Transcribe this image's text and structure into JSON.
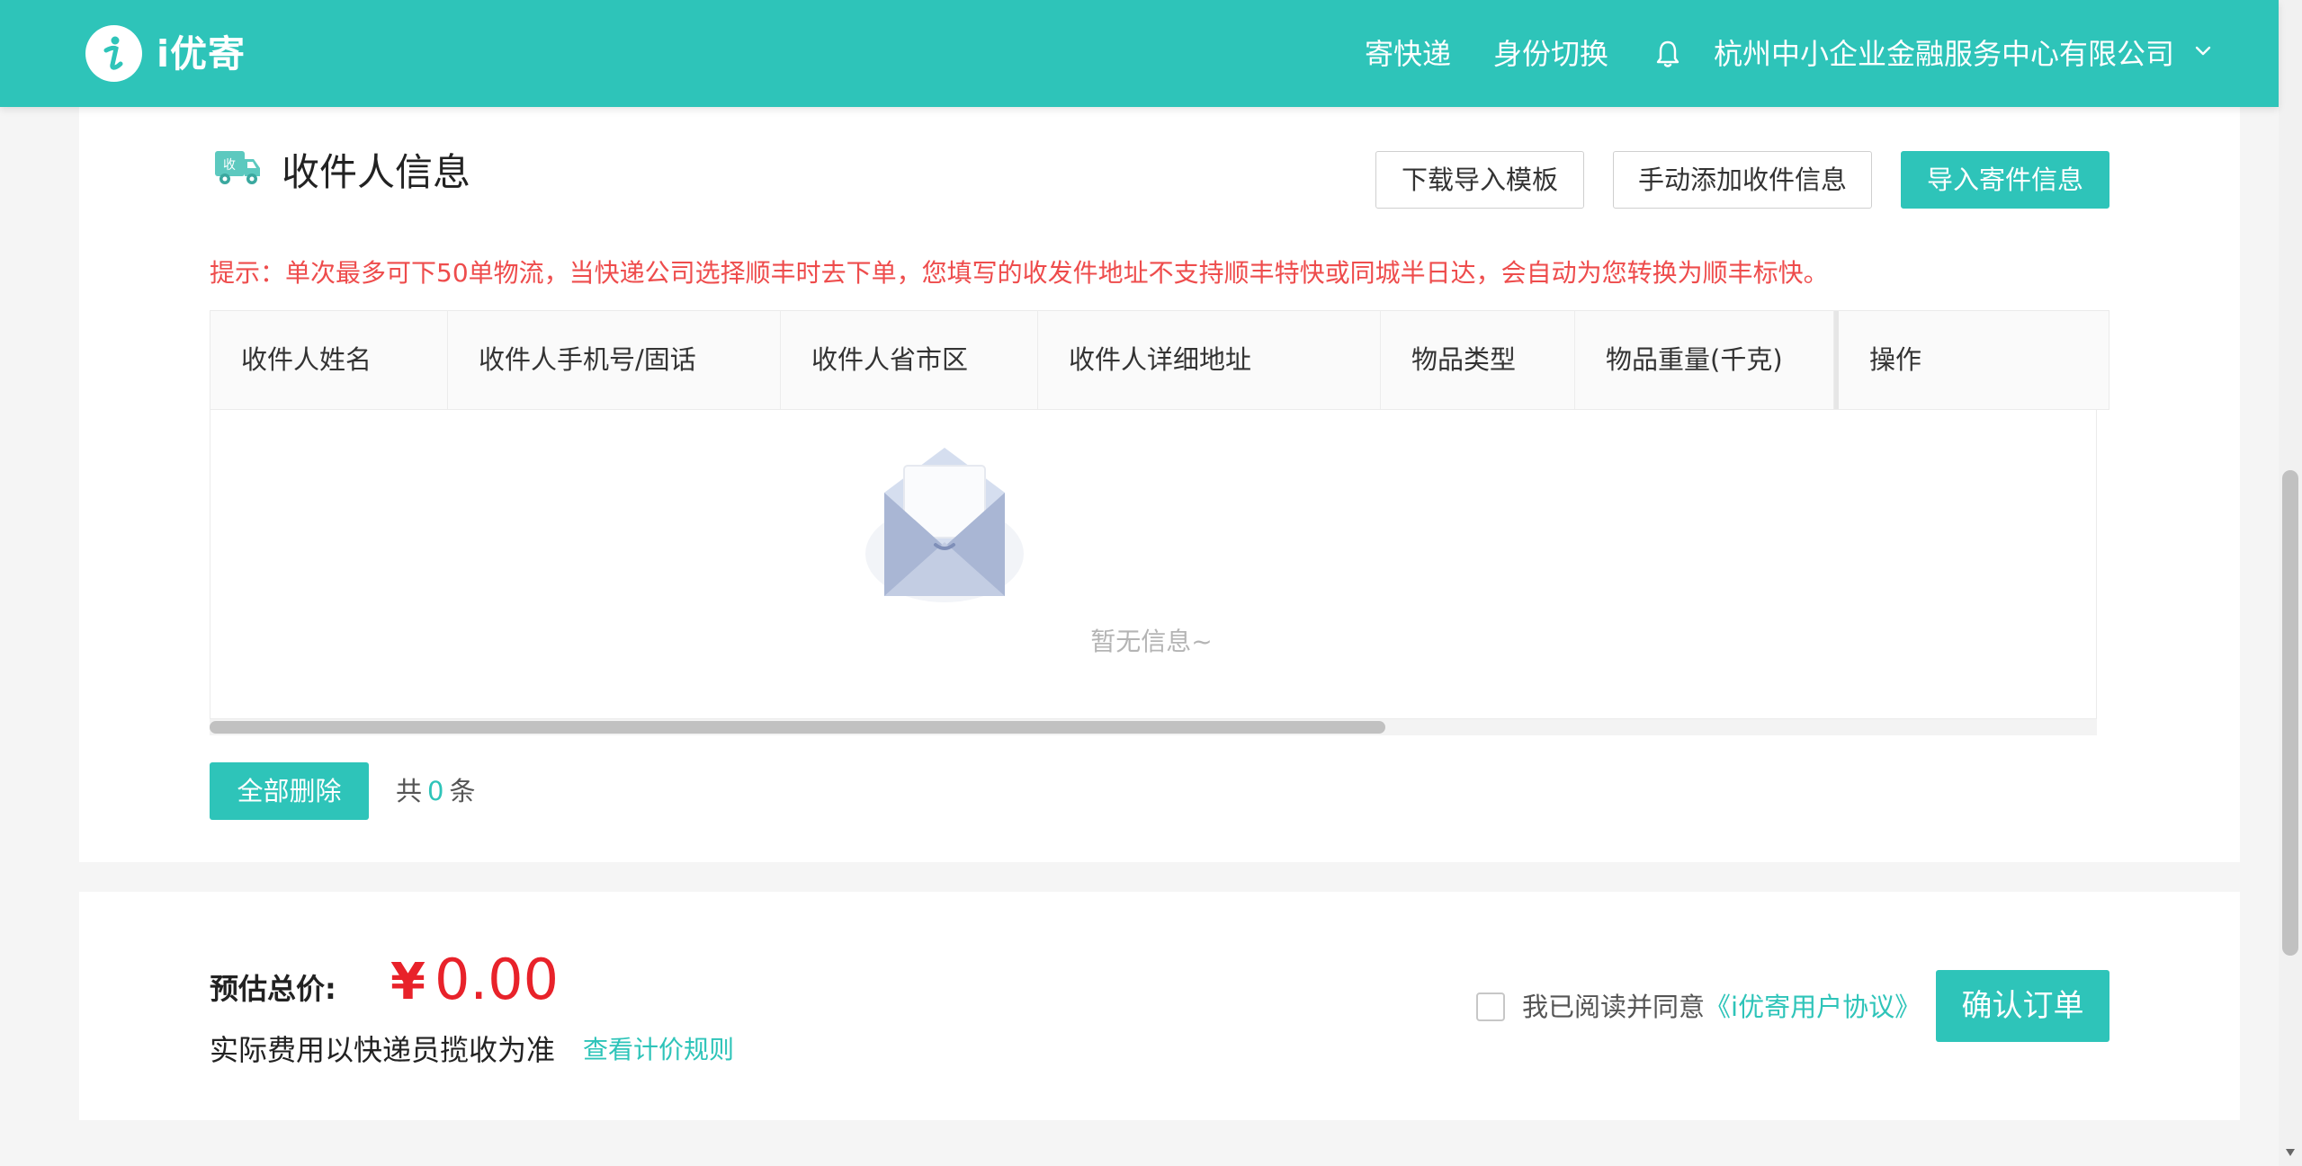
{
  "header": {
    "logo_text": "i优寄",
    "nav": {
      "send_express": "寄快递",
      "switch_identity": "身份切换",
      "company": "杭州中小企业金融服务中心有限公司"
    },
    "icons": {
      "bell": "bell-icon",
      "caret": "chevron-down-icon",
      "logo": "info-icon"
    }
  },
  "recipients": {
    "section_title": "收件人信息",
    "section_icon": "truck-icon",
    "section_icon_badge": "收",
    "buttons": {
      "download_template": "下载导入模板",
      "manual_add": "手动添加收件信息",
      "import_shipment": "导入寄件信息"
    },
    "tip": "提示：单次最多可下50单物流，当快递公司选择顺丰时去下单，您填写的收发件地址不支持顺丰特快或同城半日达，会自动为您转换为顺丰标快。",
    "table": {
      "columns": {
        "name": "收件人姓名",
        "phone": "收件人手机号/固话",
        "region": "收件人省市区",
        "address": "收件人详细地址",
        "item_type": "物品类型",
        "weight": "物品重量(千克)",
        "operation": "操作"
      },
      "rows": [],
      "empty_text": "暂无信息~",
      "empty_icon": "envelope-icon"
    },
    "delete_all": "全部删除",
    "count_prefix": "共",
    "count": "0",
    "count_suffix": "条"
  },
  "price": {
    "label": "预估总价:",
    "currency": "¥",
    "amount": "0.00",
    "note": "实际费用以快递员揽收为准",
    "rules_link": "查看计价规则",
    "agree_checked": false,
    "agree_text": "我已阅读并同意",
    "agreement_link": "《i优寄用户协议》",
    "confirm": "确认订单"
  },
  "colors": {
    "brand": "#2ec4b9",
    "warning": "#ee4c4c",
    "price": "#e8222a"
  }
}
